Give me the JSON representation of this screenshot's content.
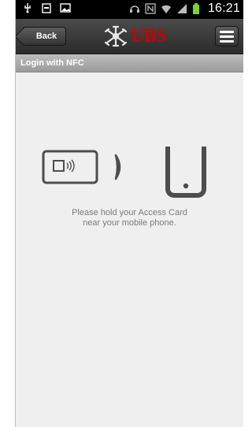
{
  "status_bar": {
    "time": "16:21",
    "icons": [
      "usb-icon",
      "sd-card-icon",
      "image-icon",
      "headset-icon",
      "nfc-icon",
      "wifi-icon",
      "signal-icon",
      "battery-icon"
    ]
  },
  "app_bar": {
    "back_label": "Back",
    "logo_text": "UBS"
  },
  "title_bar": {
    "title": "Login with NFC"
  },
  "main": {
    "instruction_line1": "Please hold your Access Card",
    "instruction_line2": "near your mobile phone."
  },
  "colors": {
    "brand_red": "#cc0000",
    "illustration_gray": "#4d4d4d",
    "background": "#efefef"
  }
}
